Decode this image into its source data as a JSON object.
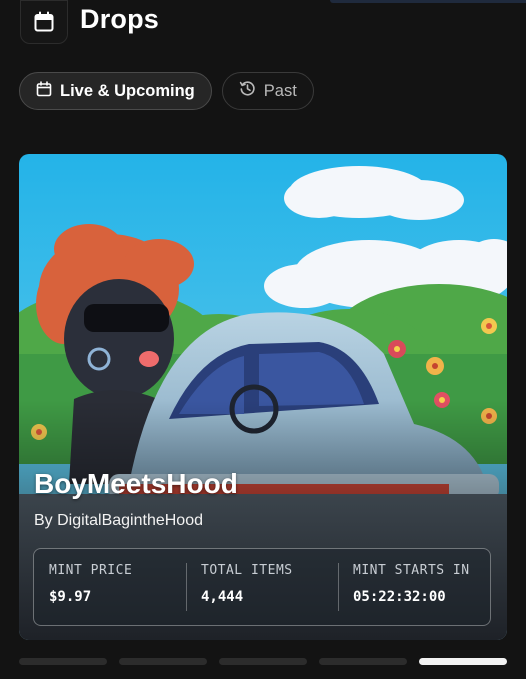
{
  "header": {
    "title": "Drops",
    "icon": "calendar-icon"
  },
  "tabs": [
    {
      "label": "Live & Upcoming",
      "icon": "calendar-icon",
      "active": true
    },
    {
      "label": "Past",
      "icon": "history-icon",
      "active": false
    }
  ],
  "drop": {
    "title": "BoyMeetsHood",
    "creator": "By DigitalBagintheHood",
    "stats": [
      {
        "label": "MINT PRICE",
        "value": "$9.97"
      },
      {
        "label": "TOTAL ITEMS",
        "value": "4,444"
      },
      {
        "label": "MINT STARTS IN",
        "value": "05:22:32:00"
      }
    ]
  },
  "pager": {
    "count": 5,
    "active_index": 4
  },
  "colors": {
    "background": "#131313",
    "sky": "#2fb6e4",
    "accent_active": "#f2f2f2"
  }
}
